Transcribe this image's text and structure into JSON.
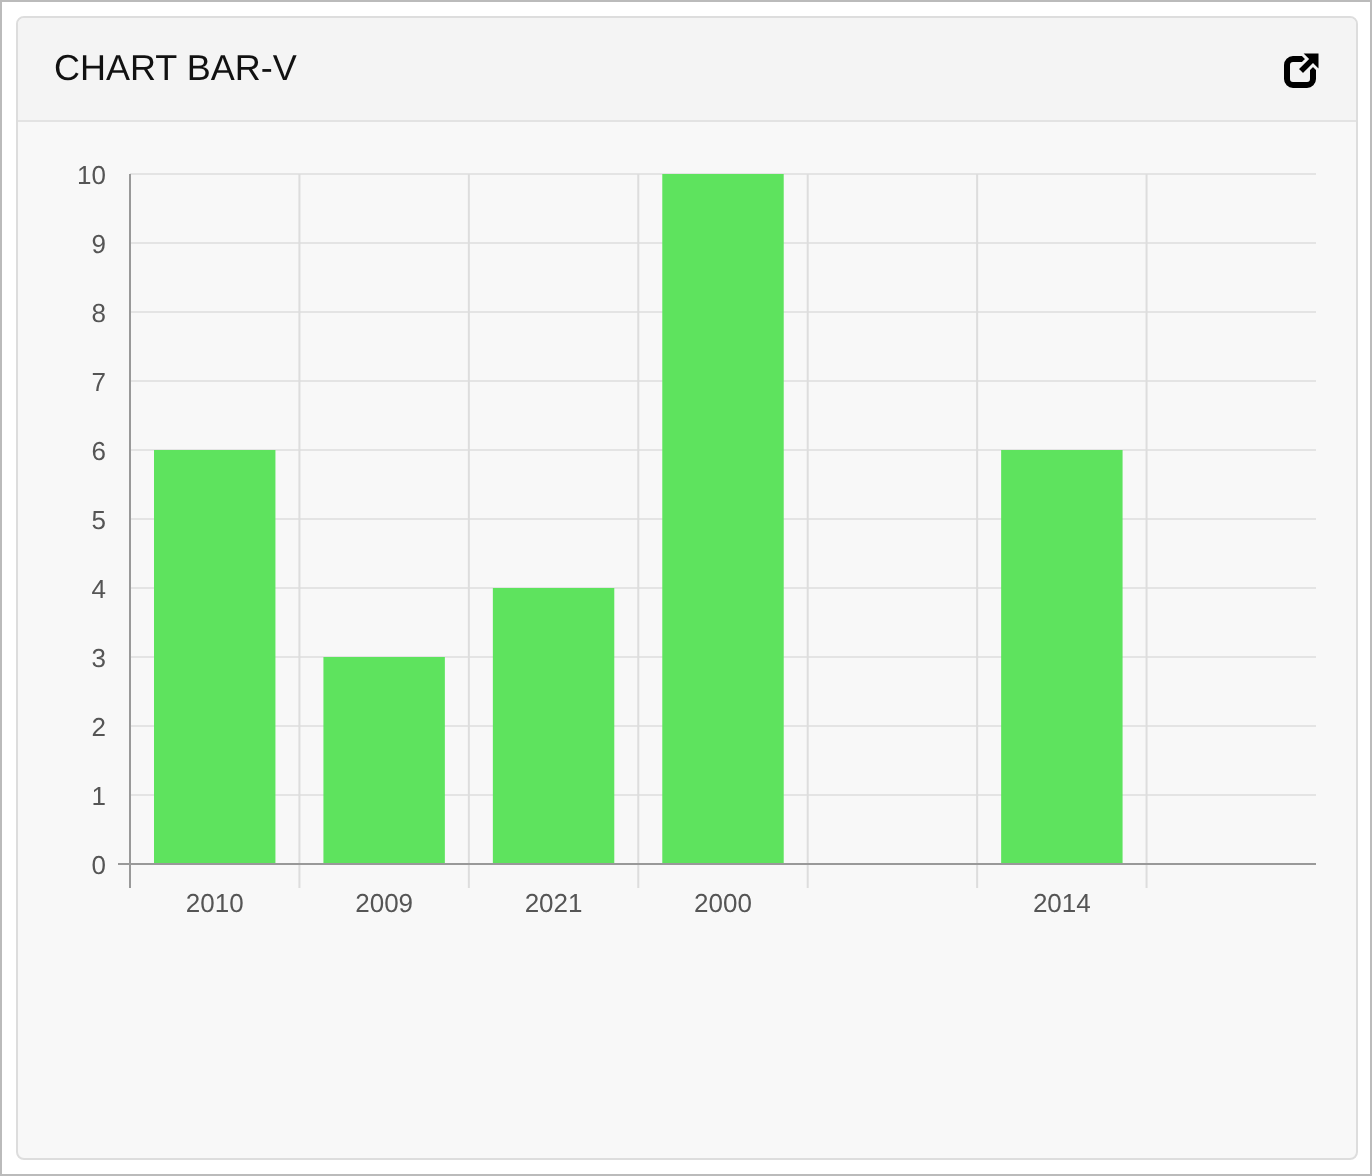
{
  "panel": {
    "title": "CHART BAR-V",
    "chart_data": {
      "type": "bar",
      "categories": [
        "2010",
        "2009",
        "2021",
        "2000",
        null,
        "2014",
        null
      ],
      "values": [
        6,
        3,
        4,
        10,
        null,
        6,
        null
      ],
      "ylim": [
        0,
        10
      ],
      "yticks": [
        0,
        1,
        2,
        3,
        4,
        5,
        6,
        7,
        8,
        9,
        10
      ],
      "grid": true
    }
  }
}
